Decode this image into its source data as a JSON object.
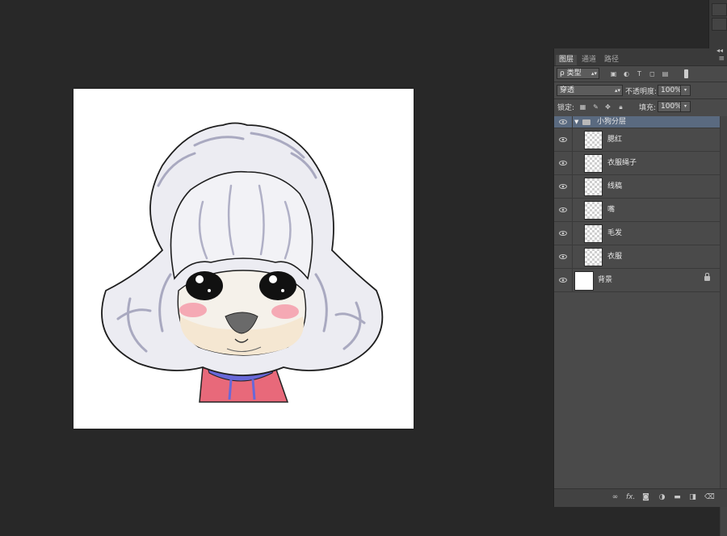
{
  "panel": {
    "collapse_glyph": "◂◂",
    "tabs": [
      {
        "label": "图层",
        "active": true
      },
      {
        "label": "通道",
        "active": false
      },
      {
        "label": "路径",
        "active": false
      }
    ],
    "menu_glyph": "≡",
    "filter": {
      "value": "ρ 类型",
      "filter_icons": [
        "image-filter-icon",
        "adjustment-filter-icon",
        "text-filter-icon",
        "shape-filter-icon",
        "smart-object-filter-icon",
        "filter-toggle-icon"
      ]
    },
    "blend_mode": "穿透",
    "opacity_label": "不透明度:",
    "opacity_value": "100%",
    "lock_label": "锁定:",
    "fill_label": "填充:",
    "fill_value": "100%",
    "group": {
      "name": "小狗分层",
      "expanded_glyph": "▼"
    },
    "layers": [
      {
        "name": "腮红",
        "thumb": "transparent"
      },
      {
        "name": "衣服绳子",
        "thumb": "transparent"
      },
      {
        "name": "线稿",
        "thumb": "transparent"
      },
      {
        "name": "嘴",
        "thumb": "transparent"
      },
      {
        "name": "毛发",
        "thumb": "transparent"
      },
      {
        "name": "衣服",
        "thumb": "transparent"
      }
    ],
    "background_layer": {
      "name": "背景",
      "locked": true
    },
    "bottom_icons": [
      "link-layers-icon",
      "fx-icon",
      "add-mask-icon",
      "adjustment-layer-icon",
      "new-group-icon",
      "new-layer-icon",
      "delete-layer-icon"
    ],
    "fx_text": "fx."
  },
  "colors": {
    "workspace": "#282828",
    "panel": "#4a4a4a",
    "selection": "#5a6a80"
  }
}
